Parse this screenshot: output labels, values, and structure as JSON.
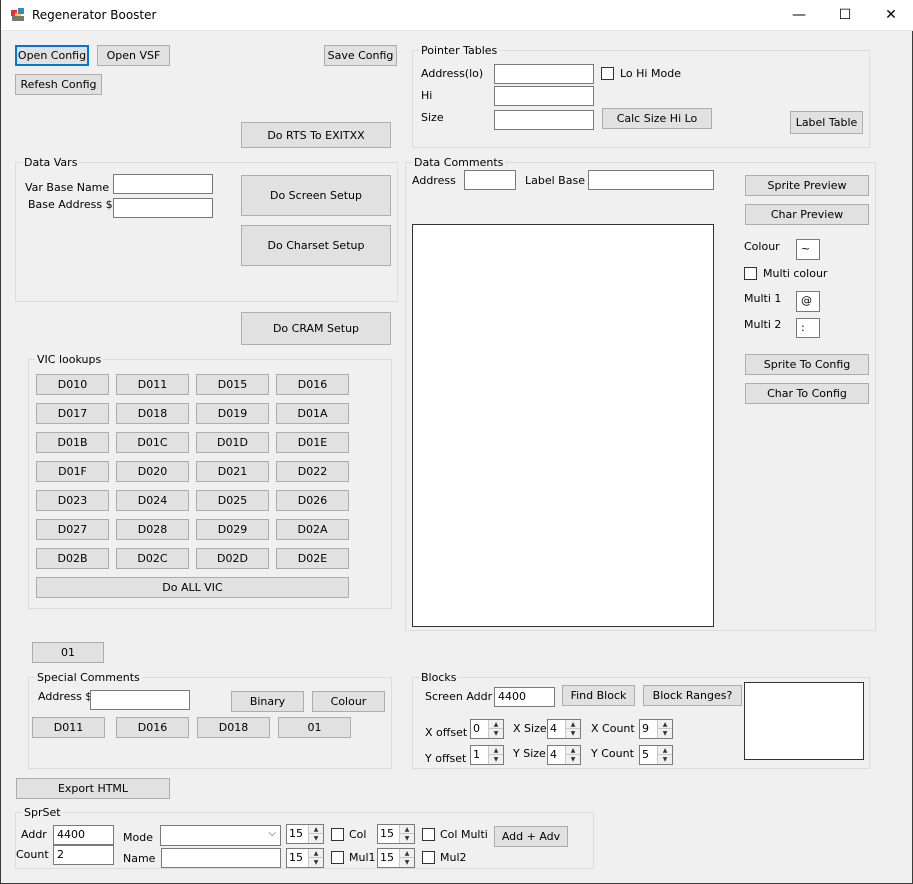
{
  "window": {
    "title": "Regenerator Booster",
    "minimize": "—",
    "maximize": "☐",
    "close": "✕"
  },
  "buttons": {
    "open_config": "Open Config",
    "open_vsf": "Open VSF",
    "save_config": "Save Config",
    "refresh_config": "Refesh Config",
    "do_rts": "Do RTS To EXITXX",
    "do_screen": "Do Screen Setup",
    "do_charset": "Do Charset Setup",
    "do_cram": "Do CRAM Setup",
    "calc_size": "Calc Size Hi Lo",
    "label_table": "Label Table",
    "sprite_preview": "Sprite Preview",
    "char_preview": "Char Preview",
    "sprite_to_config": "Sprite To Config",
    "char_to_config": "Char To Config",
    "export_html": "Export HTML",
    "find_block": "Find Block",
    "block_ranges": "Block Ranges?",
    "binary": "Binary",
    "colour": "Colour",
    "add_adv": "Add + Adv",
    "do_all_vic": "Do ALL VIC",
    "btn_01": "01"
  },
  "data_vars": {
    "title": "Data Vars",
    "var_base_name_label": "Var Base Name",
    "base_address_label": "Base Address $",
    "var_base_name": "",
    "base_address": ""
  },
  "pointer_tables": {
    "title": "Pointer Tables",
    "address_lo_label": "Address(lo)",
    "hi_label": "Hi",
    "size_label": "Size",
    "lo_hi_mode_label": "Lo Hi Mode",
    "address_lo": "",
    "hi": "",
    "size": ""
  },
  "data_comments": {
    "title": "Data Comments",
    "address_label": "Address",
    "label_base_label": "Label Base",
    "address": "",
    "label_base": "",
    "colour_label": "Colour",
    "colour_value": "~",
    "multi_colour_label": "Multi colour",
    "multi1_label": "Multi 1",
    "multi1_value": "@",
    "multi2_label": "Multi 2",
    "multi2_value": ":"
  },
  "vic_lookups": {
    "title": "VIC lookups",
    "registers": [
      "D010",
      "D011",
      "D015",
      "D016",
      "D017",
      "D018",
      "D019",
      "D01A",
      "D01B",
      "D01C",
      "D01D",
      "D01E",
      "D01F",
      "D020",
      "D021",
      "D022",
      "D023",
      "D024",
      "D025",
      "D026",
      "D027",
      "D028",
      "D029",
      "D02A",
      "D02B",
      "D02C",
      "D02D",
      "D02E"
    ]
  },
  "special_comments": {
    "title": "Special Comments",
    "address_label": "Address $",
    "address": "",
    "buttons": [
      "D011",
      "D016",
      "D018",
      "01"
    ]
  },
  "blocks": {
    "title": "Blocks",
    "screen_addr_label": "Screen Addr",
    "screen_addr": "4400",
    "x_offset_label": "X offset",
    "x_offset": "0",
    "y_offset_label": "Y offset",
    "y_offset": "1",
    "x_size_label": "X Size",
    "x_size": "4",
    "y_size_label": "Y Size",
    "y_size": "4",
    "x_count_label": "X Count",
    "x_count": "9",
    "y_count_label": "Y Count",
    "y_count": "5"
  },
  "sprset": {
    "title": "SprSet",
    "addr_label": "Addr",
    "addr": "4400",
    "count_label": "Count",
    "count": "2",
    "mode_label": "Mode",
    "mode": "",
    "name_label": "Name",
    "name": "",
    "spin1": "15",
    "spin2": "15",
    "col_label": "Col",
    "col_value": "15",
    "col_multi_label": "Col Multi",
    "mul1_label": "Mul1",
    "mul1_value": "15",
    "mul2_label": "Mul2"
  }
}
